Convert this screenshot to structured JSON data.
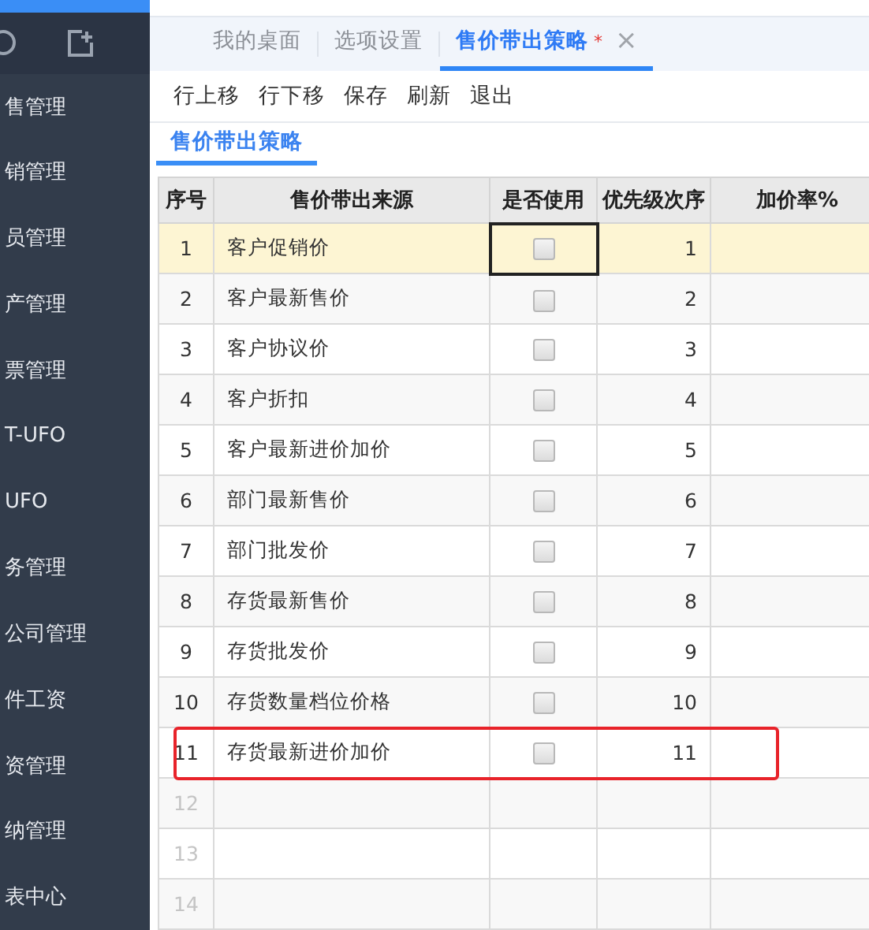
{
  "sidebar": {
    "items": [
      {
        "label": "售管理"
      },
      {
        "label": "销管理"
      },
      {
        "label": "员管理"
      },
      {
        "label": "产管理"
      },
      {
        "label": "票管理"
      },
      {
        "label": "T-UFO"
      },
      {
        "label": "UFO"
      },
      {
        "label": "务管理"
      },
      {
        "label": "公司管理"
      },
      {
        "label": "件工资"
      },
      {
        "label": "资管理"
      },
      {
        "label": "纳管理"
      },
      {
        "label": "表中心"
      }
    ]
  },
  "tabs": [
    {
      "label": "我的桌面",
      "selected": false
    },
    {
      "label": "选项设置",
      "selected": false
    },
    {
      "label": "售价带出策略",
      "selected": true,
      "modified_mark": "*",
      "close": "×"
    }
  ],
  "toolbar": [
    "行上移",
    "行下移",
    "保存",
    "刷新",
    "退出"
  ],
  "subtabs": [
    {
      "label": "售价带出策略",
      "selected": true
    }
  ],
  "table": {
    "columns": [
      "序号",
      "售价带出来源",
      "是否使用",
      "优先级次序",
      "加价率%"
    ],
    "rows": [
      {
        "no": "1",
        "source": "客户促销价",
        "checked": false,
        "priority": "1",
        "selected": true,
        "annotated": false
      },
      {
        "no": "2",
        "source": "客户最新售价",
        "checked": false,
        "priority": "2",
        "selected": false,
        "annotated": false
      },
      {
        "no": "3",
        "source": "客户协议价",
        "checked": false,
        "priority": "3",
        "selected": false,
        "annotated": false
      },
      {
        "no": "4",
        "source": "客户折扣",
        "checked": false,
        "priority": "4",
        "selected": false,
        "annotated": false
      },
      {
        "no": "5",
        "source": "客户最新进价加价",
        "checked": false,
        "priority": "5",
        "selected": false,
        "annotated": false
      },
      {
        "no": "6",
        "source": "部门最新售价",
        "checked": false,
        "priority": "6",
        "selected": false,
        "annotated": false
      },
      {
        "no": "7",
        "source": "部门批发价",
        "checked": false,
        "priority": "7",
        "selected": false,
        "annotated": false
      },
      {
        "no": "8",
        "source": "存货最新售价",
        "checked": false,
        "priority": "8",
        "selected": false,
        "annotated": false
      },
      {
        "no": "9",
        "source": "存货批发价",
        "checked": false,
        "priority": "9",
        "selected": false,
        "annotated": false
      },
      {
        "no": "10",
        "source": "存货数量档位价格",
        "checked": false,
        "priority": "10",
        "selected": false,
        "annotated": false
      },
      {
        "no": "11",
        "source": "存货最新进价加价",
        "checked": false,
        "priority": "11",
        "selected": false,
        "annotated": true
      }
    ],
    "empty_rows": [
      "12",
      "13",
      "14"
    ]
  }
}
